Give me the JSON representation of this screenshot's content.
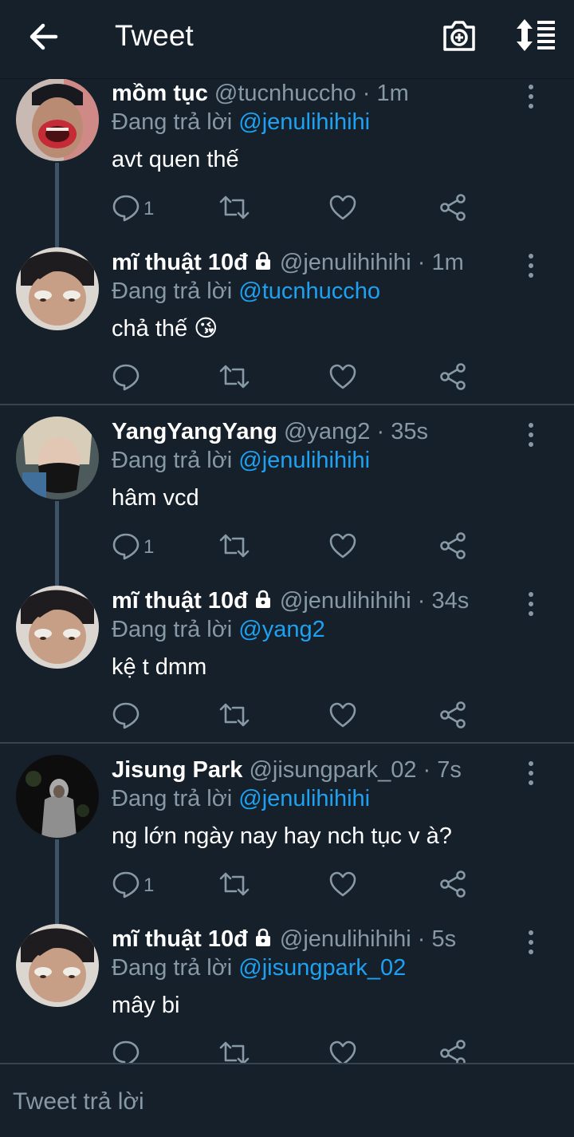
{
  "header": {
    "title": "Tweet",
    "icons": [
      "back-arrow-icon",
      "camera-add-icon",
      "sort-icon"
    ]
  },
  "tweets": [
    {
      "name": "mồm tục",
      "handle": "@tucnhuccho · 1m",
      "locked": false,
      "reply_prefix": "Đang trả lời ",
      "reply_to": "@jenulihihihi",
      "text": "avt quen thế",
      "reply_count": "1"
    },
    {
      "name": "mĩ thuật 10đ",
      "handle": "@jenulihihihi · 1m",
      "locked": true,
      "reply_prefix": "Đang trả lời ",
      "reply_to": "@tucnhuccho",
      "text": "chả thế 😘",
      "reply_count": ""
    },
    {
      "name": "YangYangYang",
      "handle": "@yang2 · 35s",
      "locked": false,
      "reply_prefix": "Đang trả lời ",
      "reply_to": "@jenulihihihi",
      "text": "hâm vcd",
      "reply_count": "1"
    },
    {
      "name": "mĩ thuật 10đ",
      "handle": "@jenulihihihi · 34s",
      "locked": true,
      "reply_prefix": "Đang trả lời ",
      "reply_to": "@yang2",
      "text": "kệ t dmm",
      "reply_count": ""
    },
    {
      "name": "Jisung Park",
      "handle": "@jisungpark_02 · 7s",
      "locked": false,
      "reply_prefix": "Đang trả lời ",
      "reply_to": "@jenulihihihi",
      "text": "ng lớn ngày nay hay nch tục v à?",
      "reply_count": "1"
    },
    {
      "name": "mĩ thuật 10đ",
      "handle": "@jenulihihihi · 5s",
      "locked": true,
      "reply_prefix": "Đang trả lời ",
      "reply_to": "@jisungpark_02",
      "text": "mây bi",
      "reply_count": ""
    }
  ],
  "compose": {
    "placeholder": "Tweet trả lời"
  },
  "colors": {
    "background": "#15202b",
    "secondary_text": "#8899a6",
    "accent": "#1da1f2",
    "divider": "#38444d"
  }
}
